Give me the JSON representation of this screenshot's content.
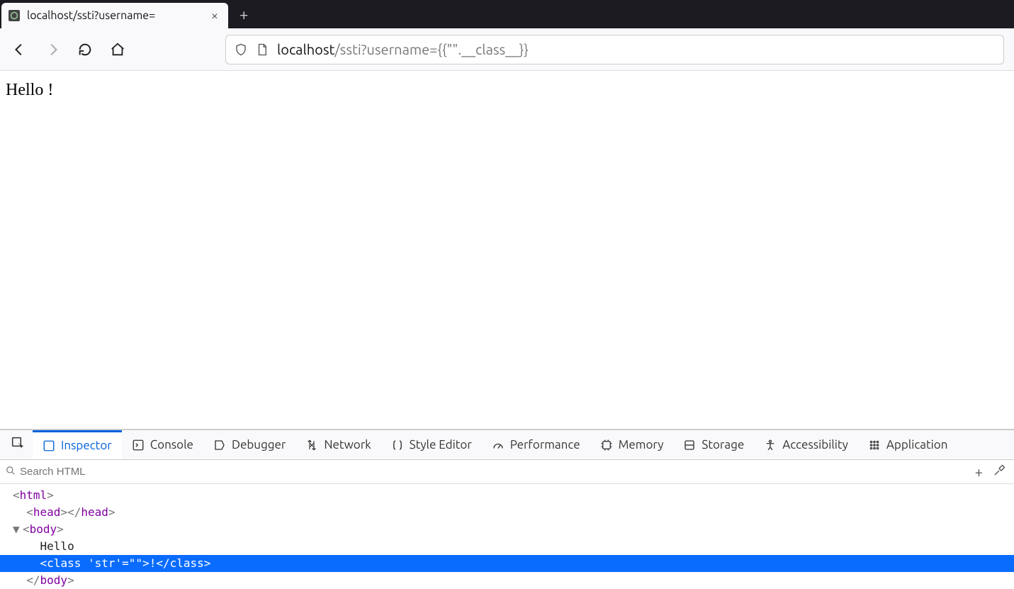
{
  "tab": {
    "title": "localhost/ssti?username=",
    "close": "×"
  },
  "newtab": "+",
  "url": {
    "host": "localhost",
    "path": "/ssti?username={{\"\".__class__}}"
  },
  "page": {
    "content": "Hello !"
  },
  "devtools": {
    "tabs": {
      "inspector": "Inspector",
      "console": "Console",
      "debugger": "Debugger",
      "network": "Network",
      "style": "Style Editor",
      "performance": "Performance",
      "memory": "Memory",
      "storage": "Storage",
      "accessibility": "Accessibility",
      "application": "Application"
    },
    "search_placeholder": "Search HTML",
    "add": "+",
    "tree": {
      "l1_open": "<",
      "l1_tag": "html",
      "l1_close": ">",
      "l2_open": "<",
      "l2_tag": "head",
      "l2_mid": "></",
      "l2_tag2": "head",
      "l2_end": ">",
      "l3_tw": "▼ ",
      "l3_open": "<",
      "l3_tag": "body",
      "l3_close": ">",
      "l4_text": "Hello",
      "l5_open": "<",
      "l5_tag": "class",
      "l5_attr": " 'str'",
      "l5_eq": "=\"\"",
      "l5_mid": ">",
      "l5_txt": "!",
      "l5_c1": "</",
      "l5_ctag": "class",
      "l5_c2": ">",
      "l6_open": "</",
      "l6_tag": "body",
      "l6_close": ">"
    }
  }
}
